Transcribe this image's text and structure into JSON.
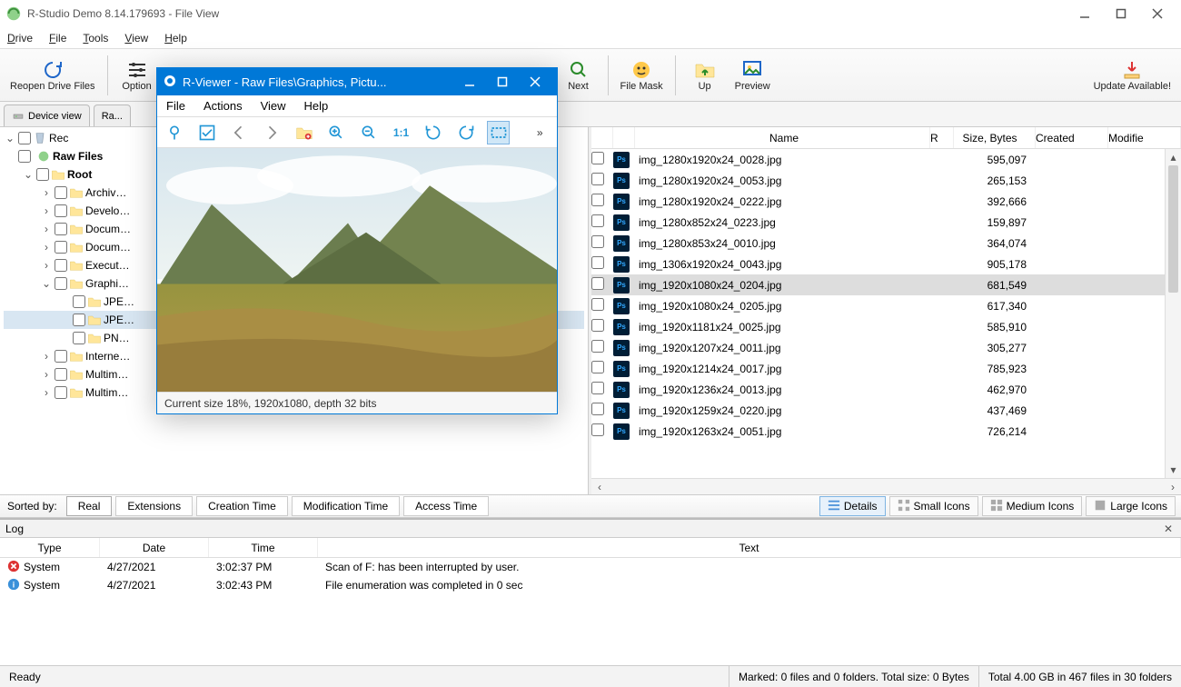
{
  "window": {
    "title": "R-Studio Demo 8.14.179693 - File View"
  },
  "menubar": [
    "Drive",
    "File",
    "Tools",
    "View",
    "Help"
  ],
  "toolbar": {
    "reopen": "Reopen Drive Files",
    "option": "Option",
    "next": "Next",
    "filemask": "File Mask",
    "up": "Up",
    "preview": "Preview",
    "update": "Update Available!"
  },
  "tabs": {
    "device_view": "Device view",
    "raw": "Ra..."
  },
  "tree": [
    {
      "label": "Rec",
      "level": 0,
      "exp": "▾",
      "kind": "recycle"
    },
    {
      "label": "Raw Files",
      "level": 0,
      "exp": "",
      "kind": "raw",
      "bold": true,
      "extra": true
    },
    {
      "label": "Root",
      "level": 1,
      "exp": "▾",
      "kind": "folder",
      "bold": true
    },
    {
      "label": "Archiv",
      "level": 2,
      "exp": "›",
      "kind": "folder",
      "cut": true
    },
    {
      "label": "Develo",
      "level": 2,
      "exp": "›",
      "kind": "folder",
      "cut": true
    },
    {
      "label": "Docum",
      "level": 2,
      "exp": "›",
      "kind": "folder",
      "cut": true
    },
    {
      "label": "Docum",
      "level": 2,
      "exp": "›",
      "kind": "folder",
      "cut": true
    },
    {
      "label": "Execut",
      "level": 2,
      "exp": "›",
      "kind": "folder",
      "cut": true
    },
    {
      "label": "Graphi",
      "level": 2,
      "exp": "▾",
      "kind": "folder",
      "cut": true
    },
    {
      "label": "JPE",
      "level": 3,
      "exp": "",
      "kind": "folder",
      "cut": true
    },
    {
      "label": "JPE",
      "level": 3,
      "exp": "",
      "kind": "folder",
      "cut": true,
      "selected": true
    },
    {
      "label": "PN",
      "level": 3,
      "exp": "",
      "kind": "folder",
      "cut": true
    },
    {
      "label": "Interne",
      "level": 2,
      "exp": "›",
      "kind": "folder",
      "cut": true
    },
    {
      "label": "Multim",
      "level": 2,
      "exp": "›",
      "kind": "folder",
      "cut": true
    },
    {
      "label": "Multim",
      "level": 2,
      "exp": "›",
      "kind": "folder",
      "cut": true
    }
  ],
  "file_headers": {
    "name": "Name",
    "r": "R",
    "size": "Size, Bytes",
    "created": "Created",
    "modified": "Modifie"
  },
  "files": [
    {
      "name": "img_1280x1920x24_0028.jpg",
      "size": "595,097"
    },
    {
      "name": "img_1280x1920x24_0053.jpg",
      "size": "265,153"
    },
    {
      "name": "img_1280x1920x24_0222.jpg",
      "size": "392,666"
    },
    {
      "name": "img_1280x852x24_0223.jpg",
      "size": "159,897"
    },
    {
      "name": "img_1280x853x24_0010.jpg",
      "size": "364,074"
    },
    {
      "name": "img_1306x1920x24_0043.jpg",
      "size": "905,178"
    },
    {
      "name": "img_1920x1080x24_0204.jpg",
      "size": "681,549",
      "selected": true
    },
    {
      "name": "img_1920x1080x24_0205.jpg",
      "size": "617,340"
    },
    {
      "name": "img_1920x1181x24_0025.jpg",
      "size": "585,910"
    },
    {
      "name": "img_1920x1207x24_0011.jpg",
      "size": "305,277"
    },
    {
      "name": "img_1920x1214x24_0017.jpg",
      "size": "785,923"
    },
    {
      "name": "img_1920x1236x24_0013.jpg",
      "size": "462,970"
    },
    {
      "name": "img_1920x1259x24_0220.jpg",
      "size": "437,469"
    },
    {
      "name": "img_1920x1263x24_0051.jpg",
      "size": "726,214"
    }
  ],
  "sort": {
    "label": "Sorted by:",
    "buttons": [
      "Real",
      "Extensions",
      "Creation Time",
      "Modification Time",
      "Access Time"
    ],
    "active": 0
  },
  "view_btns": [
    "Details",
    "Small Icons",
    "Medium Icons",
    "Large Icons"
  ],
  "log": {
    "title": "Log",
    "headers": {
      "type": "Type",
      "date": "Date",
      "time": "Time",
      "text": "Text"
    },
    "rows": [
      {
        "icon": "err",
        "type": "System",
        "date": "4/27/2021",
        "time": "3:02:37 PM",
        "text": "Scan of F: has been interrupted by user."
      },
      {
        "icon": "info",
        "type": "System",
        "date": "4/27/2021",
        "time": "3:02:43 PM",
        "text": "File enumeration was completed in 0 sec"
      }
    ]
  },
  "status": {
    "ready": "Ready",
    "marked": "Marked: 0 files and 0 folders. Total size: 0 Bytes",
    "total": "Total 4.00 GB in 467 files in 30 folders"
  },
  "rviewer": {
    "title": "R-Viewer - Raw Files\\Graphics, Pictu...",
    "menu": [
      "File",
      "Actions",
      "View",
      "Help"
    ],
    "status": "Current size 18%, 1920x1080, depth 32 bits"
  }
}
